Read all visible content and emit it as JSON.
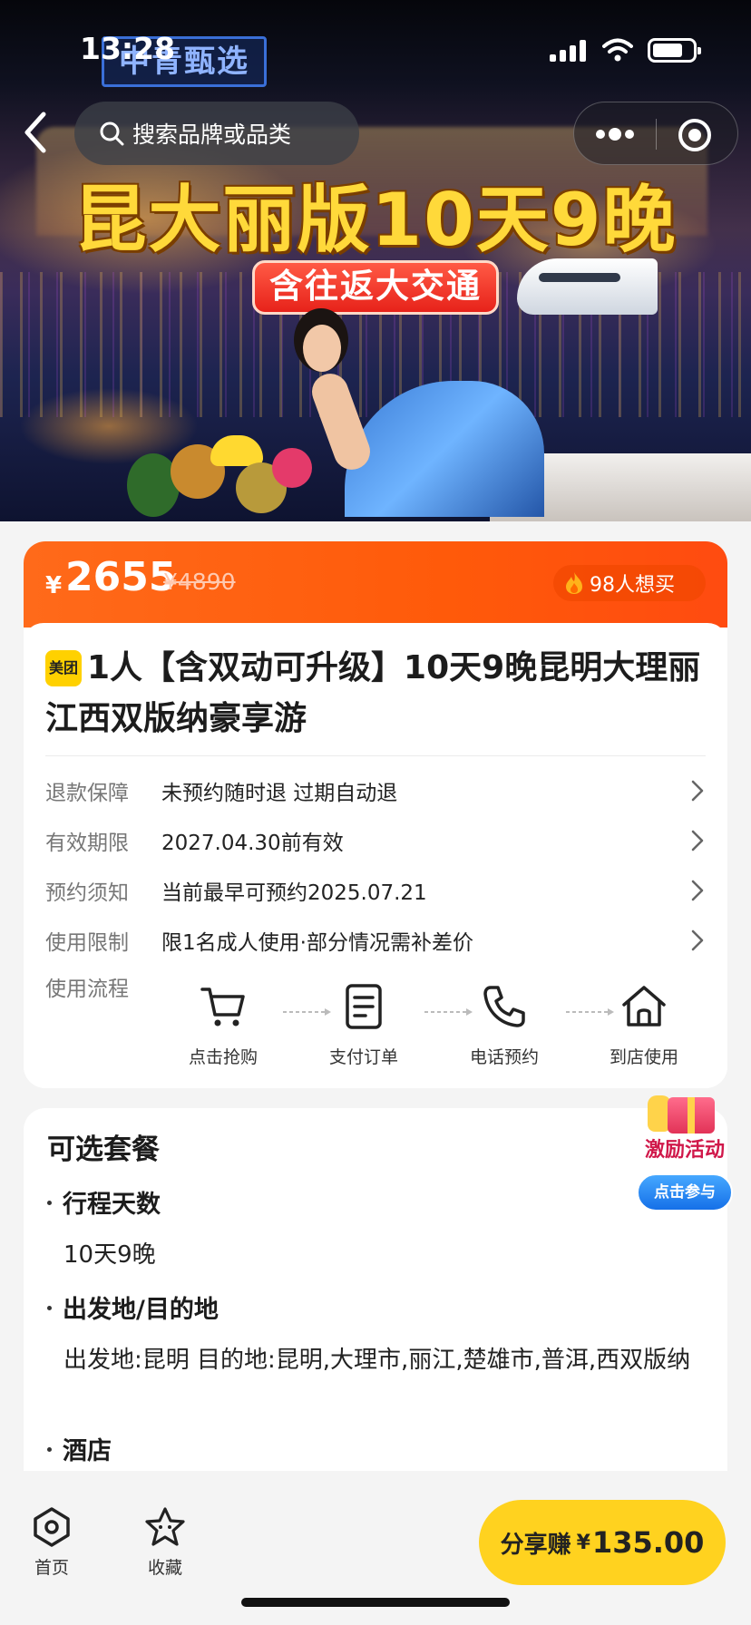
{
  "status_bar": {
    "time": "13:28"
  },
  "hero": {
    "brand_logo": "中青甄选",
    "headline": "昆大丽版10天9晚",
    "sub_badge": "含往返大交通"
  },
  "nav": {
    "search_placeholder": "搜索品牌或品类"
  },
  "price": {
    "currency": "¥",
    "current": "2655",
    "original": "¥4890",
    "want_count": "98人想买"
  },
  "product": {
    "platform_tag": "美团",
    "title": "1人【含双动可升级】10天9晚昆明大理丽江西双版纳豪享游"
  },
  "info_rows": [
    {
      "label": "退款保障",
      "value": "未预约随时退 过期自动退"
    },
    {
      "label": "有效期限",
      "value": "2027.04.30前有效"
    },
    {
      "label": "预约须知",
      "value": "当前最早可预约2025.07.21"
    },
    {
      "label": "使用限制",
      "value": "限1名成人使用·部分情况需补差价"
    }
  ],
  "flow": {
    "label": "使用流程",
    "steps": [
      "点击抢购",
      "支付订单",
      "电话预约",
      "到店使用"
    ]
  },
  "package": {
    "title": "可选套餐",
    "sections": [
      {
        "name": "行程天数",
        "value": "10天9晚"
      },
      {
        "name": "出发地/目的地",
        "value": "出发地:昆明 目的地:昆明,大理市,丽江,楚雄市,普洱,西双版纳"
      },
      {
        "name": "酒店",
        "value": ""
      }
    ]
  },
  "activity": {
    "label": "激励活动",
    "button": "点击参与"
  },
  "bottom_bar": {
    "home_label": "首页",
    "favorite_label": "收藏",
    "share_label": "分享赚",
    "share_currency": "¥",
    "share_amount": "135.00"
  },
  "colors": {
    "price_bar": "#ff5a0a",
    "share_button": "#ffd21f",
    "headline": "#ffd93a"
  }
}
